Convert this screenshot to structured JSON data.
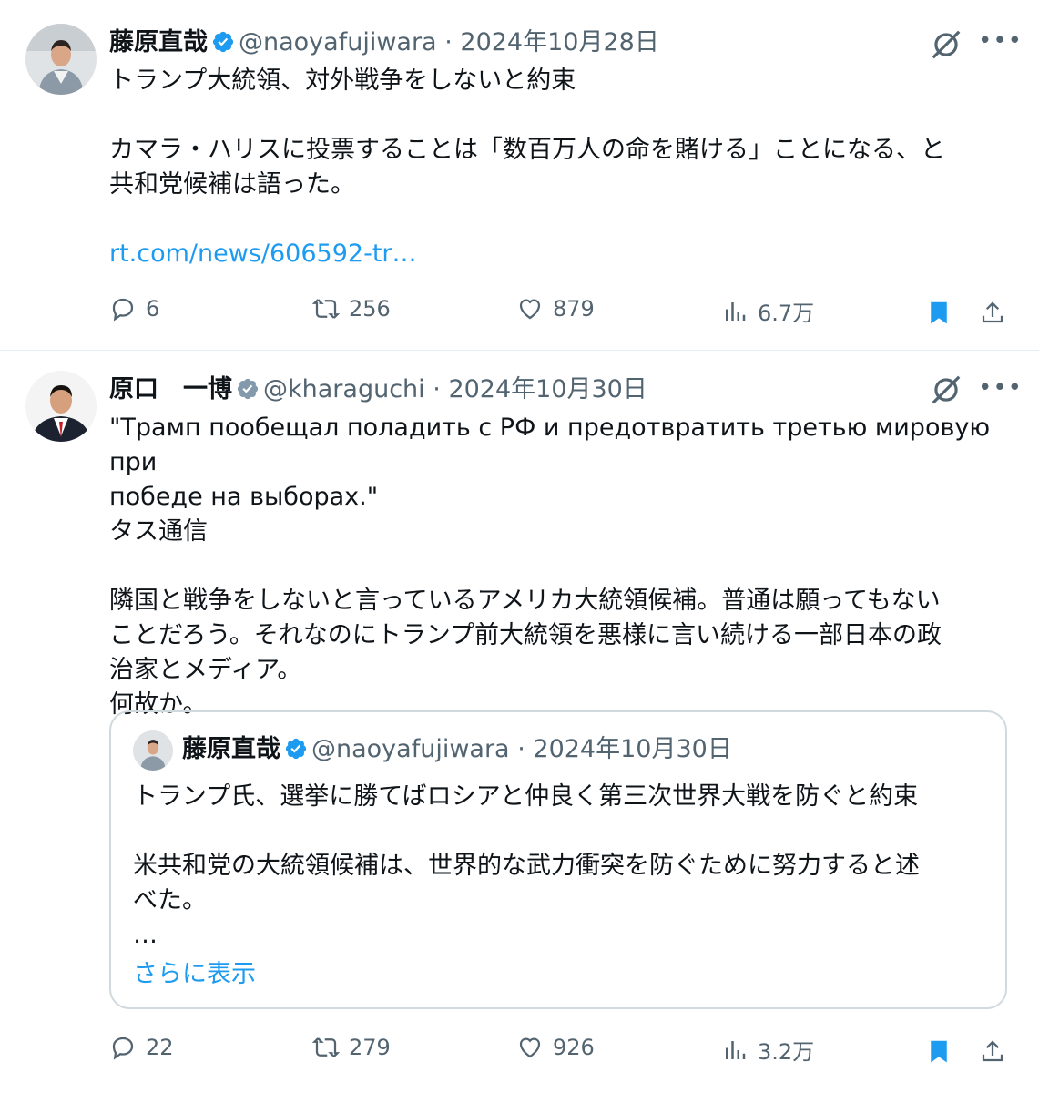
{
  "tweets": [
    {
      "name": "藤原直哉",
      "handle": "@naoyafujiwara",
      "separator": "·",
      "date": "2024年10月28日",
      "text": "トランプ大統領、対外戦争をしないと約束\n\nカマラ・ハリスに投票することは「数百万人の命を賭ける」ことになる、と\n共和党候補は語った。\n\n",
      "link": "rt.com/news/606592-tr…",
      "replies": "6",
      "retweets": "256",
      "likes": "879",
      "views": "6.7万"
    },
    {
      "name": "原口　一博",
      "handle": "@kharaguchi",
      "separator": "·",
      "date": "2024年10月30日",
      "text": "\"Трамп пообещал поладить с РФ и предотвратить третью мировую при\nпобеде на выборах.\"\nタス通信\n\n隣国と戦争をしないと言っているアメリカ大統領候補。普通は願ってもない\nことだろう。それなのにトランプ前大統領を悪様に言い続ける一部日本の政\n治家とメディア。\n何故か。",
      "quote": {
        "name": "藤原直哉",
        "handle": "@naoyafujiwara",
        "separator": "·",
        "date": "2024年10月30日",
        "text": "トランプ氏、選挙に勝てばロシアと仲良く第三次世界大戦を防ぐと約束\n\n米共和党の大統領候補は、世界的な武力衝突を防ぐために努力すると述\nべた。\n…",
        "show_more": "さらに表示"
      },
      "replies": "22",
      "retweets": "279",
      "likes": "926",
      "views": "3.2万"
    }
  ],
  "colors": {
    "accent": "#1d9bf0",
    "muted": "#536471",
    "text": "#0f1419",
    "bookmark": "#1d9bf0"
  },
  "icons": [
    "verified-badge-icon",
    "grok-icon",
    "more-icon",
    "reply-icon",
    "retweet-icon",
    "like-icon",
    "views-icon",
    "bookmark-icon",
    "share-icon"
  ]
}
